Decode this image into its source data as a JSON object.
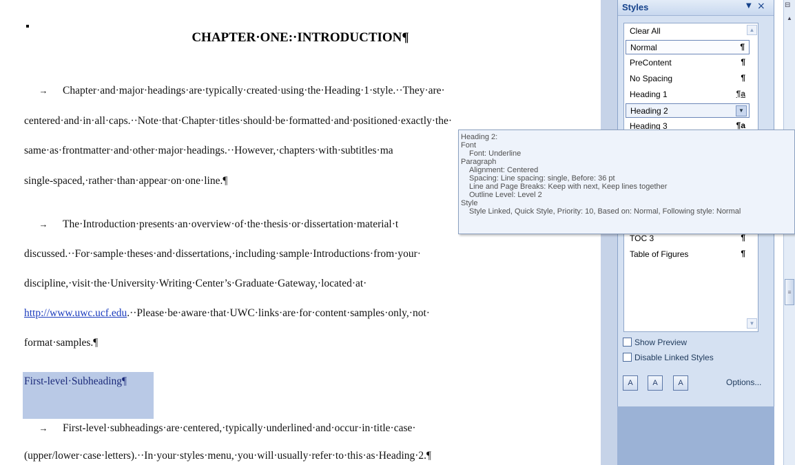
{
  "document": {
    "title": "CHAPTER·ONE:·INTRODUCTION¶",
    "tab_arrow": "→",
    "paragraph1": {
      "line1": "Chapter·and·major·headings·are·typically·created·using·the·Heading·1·style.··They·are·",
      "line2": "centered·and·in·all·caps.··Note·that·Chapter·titles·should·be·formatted·and·positioned·exactly·the·",
      "line3": "same·as·frontmatter·and·other·major·headings.··However,·chapters·with·subtitles·ma",
      "line4": "single-spaced,·rather·than·appear·on·one·line.¶"
    },
    "paragraph2": {
      "line1": "The·Introduction·presents·an·overview·of·the·thesis·or·dissertation·material·t",
      "line2": "discussed.··For·sample·theses·and·dissertations,·including·sample·Introductions·from·your·",
      "line3": "discipline,·visit·the·University·Writing·Center’s·Graduate·Gateway,·located·at·",
      "line4_link": "http://www.uwc.ucf.edu",
      "line4_rest": ".··Please·be·aware·that·UWC·links·are·for·content·samples·only,·not·",
      "line5": "format·samples.¶"
    },
    "subheading": "First-level·Subheading¶",
    "paragraph3": {
      "line1": "First-level·subheadings·are·centered,·typically·underlined·and·occur·in·title·case·",
      "line2": "(upper/lower·case·letters).··In·your·styles·menu,·you·will·usually·refer·to·this·as·Heading·2.¶"
    }
  },
  "styles_pane": {
    "title": "Styles",
    "menu_glyph": "▼",
    "close_glyph": "×",
    "items": [
      {
        "name": "Clear All",
        "mark": ""
      },
      {
        "name": "Normal",
        "mark": "¶"
      },
      {
        "name": "PreContent",
        "mark": "¶"
      },
      {
        "name": "No Spacing",
        "mark": "¶"
      },
      {
        "name": "Heading 1",
        "mark": "¶a"
      },
      {
        "name": "Heading 2",
        "mark": ""
      },
      {
        "name": "Heading 3",
        "mark": "¶a"
      },
      {
        "name": "TOC 3",
        "mark": "¶"
      },
      {
        "name": "Table of Figures",
        "mark": "¶"
      }
    ],
    "show_preview": "Show Preview",
    "disable_linked": "Disable Linked Styles",
    "options": "Options...",
    "icons": [
      "new-style-icon",
      "style-inspector-icon",
      "manage-styles-icon"
    ]
  },
  "tooltip": {
    "header": "Heading 2:",
    "font_label": "Font",
    "font_value": "Font: Underline",
    "paragraph_label": "Paragraph",
    "alignment": "Alignment: Centered",
    "spacing": "Spacing: Line spacing: single, Before: 36 pt",
    "breaks": "Line and Page Breaks: Keep with next, Keep lines together",
    "outline": "Outline Level: Level 2",
    "style_label": "Style",
    "style_value": "Style Linked, Quick Style, Priority: 10, Based on: Normal, Following style: Normal"
  }
}
